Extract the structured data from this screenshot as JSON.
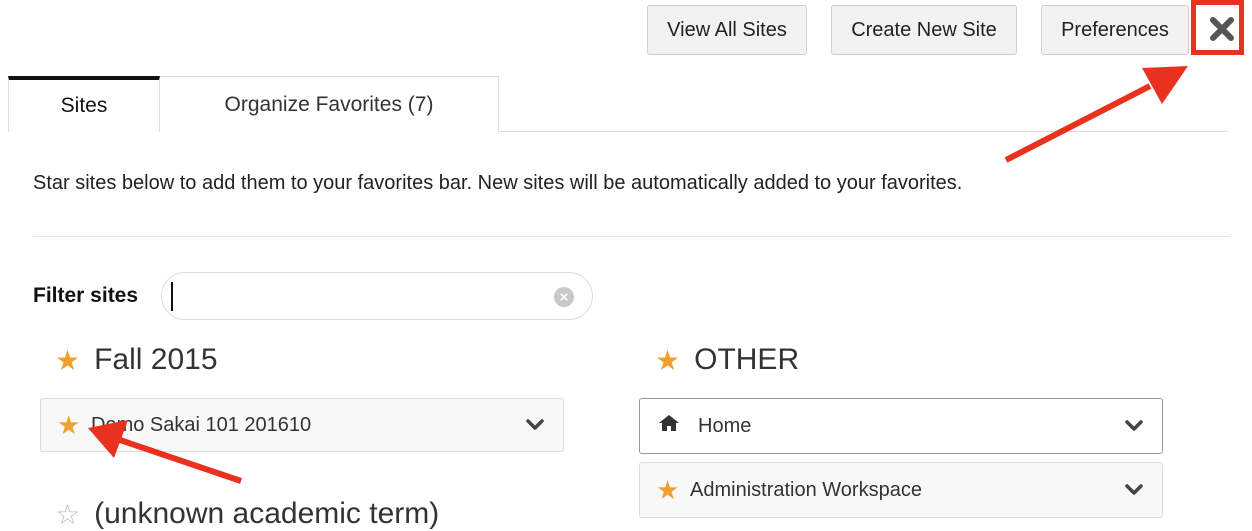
{
  "toolbar": {
    "view_all_sites": "View All Sites",
    "create_new_site": "Create New Site",
    "preferences": "Preferences",
    "close_icon": "close-icon"
  },
  "tabs": [
    {
      "label": "Sites",
      "active": true
    },
    {
      "label": "Organize Favorites (7)",
      "active": false
    }
  ],
  "intro_text": "Star sites below to add them to your favorites bar. New sites will be automatically added to your favorites.",
  "filter": {
    "label": "Filter sites",
    "value": "",
    "clear_icon": "clear-circle-icon"
  },
  "terms": {
    "fall": {
      "title": "Fall 2015",
      "starred": true,
      "sites": [
        {
          "label": "Demo Sakai 101 201610",
          "starred": true
        }
      ]
    },
    "other": {
      "title": "OTHER",
      "starred": true,
      "sites": [
        {
          "label": "Home",
          "icon": "home-icon"
        },
        {
          "label": "Administration Workspace",
          "starred": true
        }
      ]
    },
    "unknown": {
      "title": "(unknown academic term)",
      "starred": false
    }
  },
  "colors": {
    "star": "#f0a030",
    "annotation": "#e8321f",
    "active_tab_border": "#111111"
  }
}
